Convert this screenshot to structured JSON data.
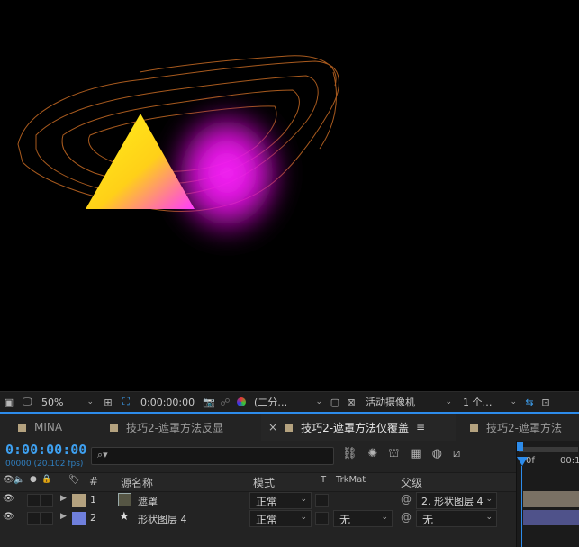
{
  "viewer_toolbar": {
    "zoom": "50%",
    "time": "0:00:00:00",
    "resolution": "(二分…",
    "camera": "活动摄像机",
    "views": "1 个…"
  },
  "tabs": [
    {
      "label": "MINA"
    },
    {
      "label": "技巧2-遮罩方法反显"
    },
    {
      "label": "技巧2-遮罩方法仅覆盖",
      "close": "×",
      "menu": "≡"
    },
    {
      "label": "技巧2-遮罩方法"
    }
  ],
  "timeline": {
    "timecode": "0:00:00:00",
    "fps": "00000 (20.102 fps)",
    "ruler_start": "0f",
    "ruler_next": "00:1"
  },
  "columns": {
    "num": "#",
    "source": "源名称",
    "mode": "模式",
    "t": "T",
    "trkmat": "TrkMat",
    "parent": "父级"
  },
  "layers": [
    {
      "num": "1",
      "name": "遮罩",
      "mode": "正常",
      "trkmat": "",
      "parent": "2. 形状图层 4",
      "label_color": "#b4a27f",
      "bar_color": "#7a7164"
    },
    {
      "num": "2",
      "name": "形状图层 4",
      "mode": "正常",
      "trkmat": "无",
      "parent": "无",
      "label_color": "#6f7fdc",
      "bar_color": "#4f528a"
    }
  ],
  "colors": {
    "accent": "#2d8ceb",
    "triangle_top": "#ffe81a",
    "glow": "#ff22ff",
    "paths": "#a85a1e"
  },
  "icons": [
    "monitor-icon",
    "display-icon",
    "camera-icon",
    "color-icon",
    "search-icon",
    "eye-icon",
    "audio-icon",
    "solo-icon",
    "lock-icon",
    "label-icon",
    "star-icon",
    "spiral-icon",
    "triangle-icon"
  ]
}
